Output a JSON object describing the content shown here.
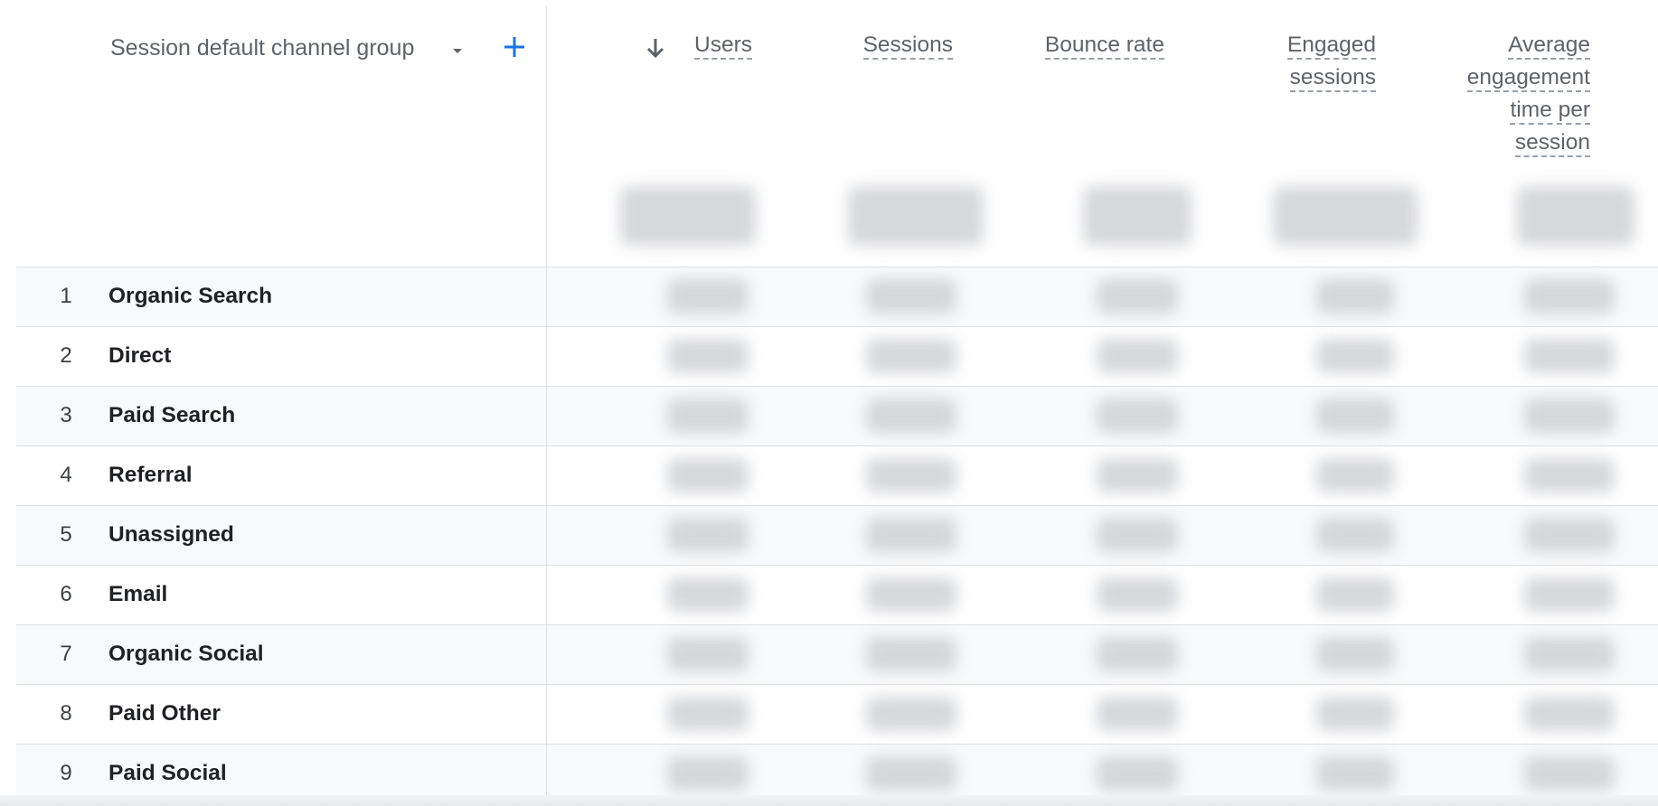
{
  "dimension": {
    "label": "Session default channel group"
  },
  "metrics": {
    "users": "Users",
    "sessions": "Sessions",
    "bounce_rate": "Bounce rate",
    "engaged_sessions": [
      "Engaged",
      "sessions"
    ],
    "avg_engagement": [
      "Average",
      "engagement",
      "time per",
      "session"
    ]
  },
  "sort": {
    "icon": "arrow-down-icon",
    "column": "Users"
  },
  "rows": [
    {
      "rank": "1",
      "channel": "Organic Search"
    },
    {
      "rank": "2",
      "channel": "Direct"
    },
    {
      "rank": "3",
      "channel": "Paid Search"
    },
    {
      "rank": "4",
      "channel": "Referral"
    },
    {
      "rank": "5",
      "channel": "Unassigned"
    },
    {
      "rank": "6",
      "channel": "Email"
    },
    {
      "rank": "7",
      "channel": "Organic Social"
    },
    {
      "rank": "8",
      "channel": "Paid Other"
    },
    {
      "rank": "9",
      "channel": "Paid Social"
    }
  ],
  "colors": {
    "accent": "#1a73e8",
    "border": "#e0e0e0",
    "alt_row": "#f8f9fa"
  }
}
